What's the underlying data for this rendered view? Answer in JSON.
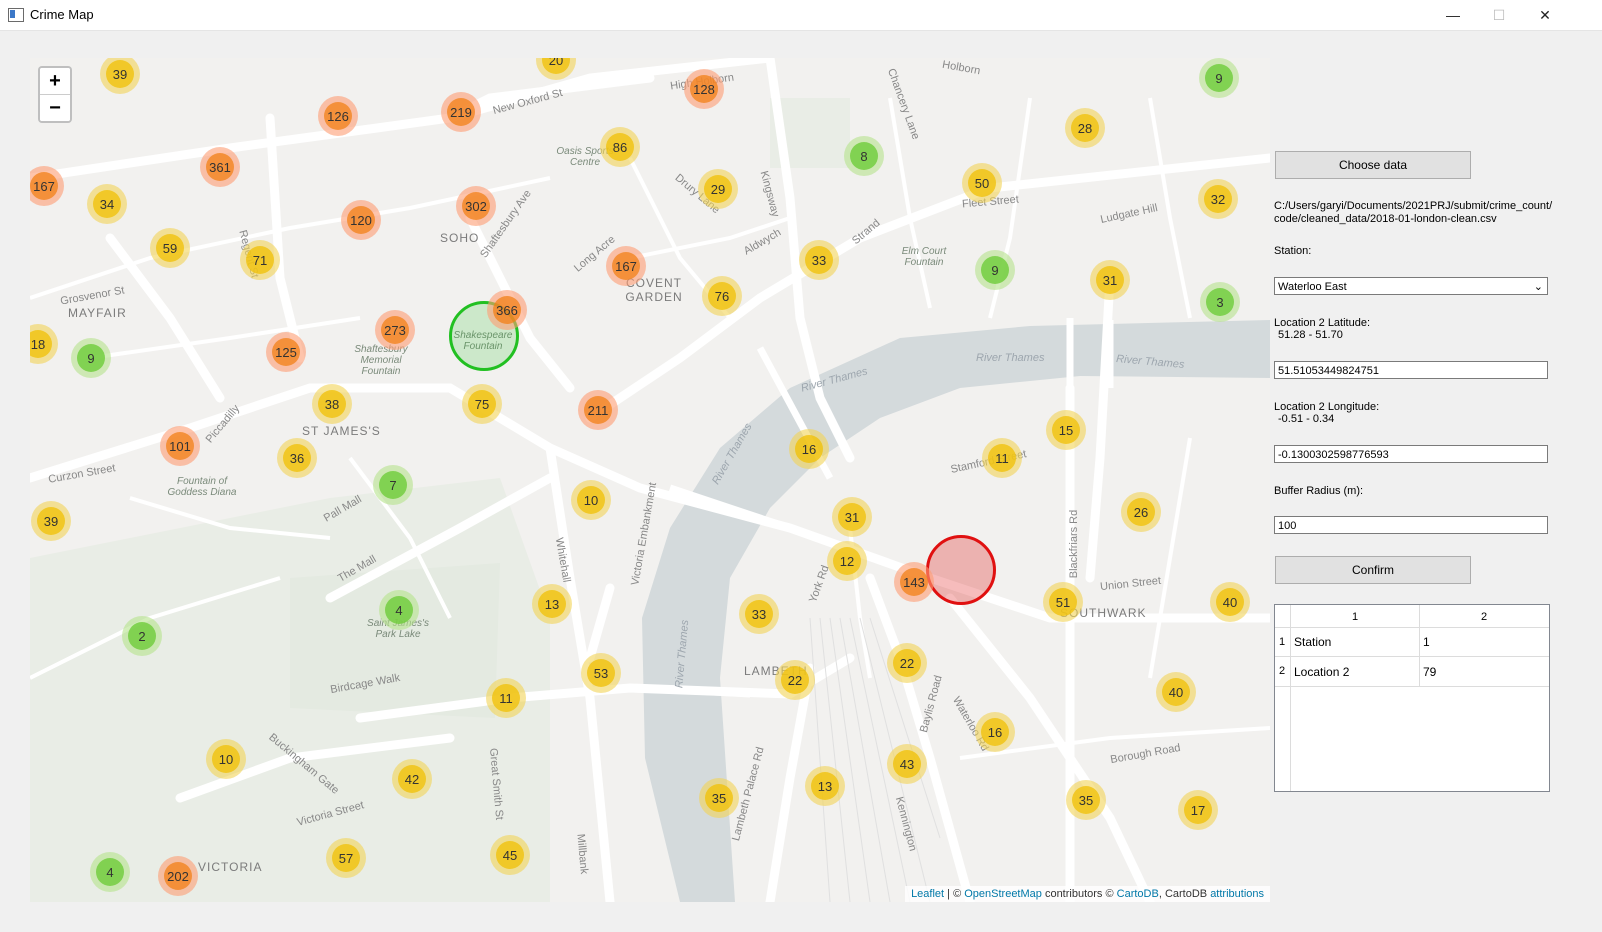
{
  "window": {
    "title": "Crime Map",
    "minimize": "—",
    "maximize": "☐",
    "close": "✕"
  },
  "map": {
    "zoom_in": "+",
    "zoom_out": "−",
    "area_labels": [
      "MAYFAIR",
      "SOHO",
      "COVENT GARDEN",
      "ST JAMES'S",
      "SOUTHWARK",
      "LAMBETH",
      "VICTORIA"
    ],
    "street_labels": [
      "New Oxford St",
      "High Holborn",
      "Holborn",
      "Shaftesbury Ave",
      "Strand",
      "Long Acre",
      "Piccadilly",
      "Pall Mall",
      "The Mall",
      "Whitehall",
      "Victoria Embankment",
      "Stamford Street",
      "Union Street",
      "Blackfriars Rd",
      "Waterloo Rd",
      "Birdcage Walk",
      "Victoria Street",
      "Regent St",
      "Kingsway",
      "Aldwych",
      "Fleet Street",
      "Chancery Lane",
      "Drury Lane",
      "Curzon Street",
      "Grosvenor St",
      "Ludgate Hill",
      "York Rd",
      "Borough Road",
      "Lambeth Palace Rd",
      "Baylis Road",
      "Buckingham Gate",
      "Great Smith St",
      "Millbank",
      "Kennington"
    ],
    "water_labels": [
      "River Thames",
      "River Thames",
      "River Thames",
      "River Thames",
      "River Thames"
    ],
    "park_labels": [
      "Shakespeare Fountain",
      "Shaftesbury Memorial Fountain",
      "Fountain of Goddess Diana",
      "Saint James's Park Lake",
      "Elm Court Fountain",
      "Oasis Sports Centre"
    ],
    "clusters": [
      {
        "count": 39,
        "level": "yellow"
      },
      {
        "count": 20,
        "level": "yellow"
      },
      {
        "count": 126,
        "level": "orange"
      },
      {
        "count": 219,
        "level": "orange"
      },
      {
        "count": 128,
        "level": "orange"
      },
      {
        "count": 9,
        "level": "green"
      },
      {
        "count": 361,
        "level": "orange"
      },
      {
        "count": 167,
        "level": "orange"
      },
      {
        "count": 34,
        "level": "yellow"
      },
      {
        "count": 86,
        "level": "yellow"
      },
      {
        "count": 8,
        "level": "green"
      },
      {
        "count": 28,
        "level": "yellow"
      },
      {
        "count": 302,
        "level": "orange"
      },
      {
        "count": 120,
        "level": "orange"
      },
      {
        "count": 29,
        "level": "yellow"
      },
      {
        "count": 50,
        "level": "yellow"
      },
      {
        "count": 32,
        "level": "yellow"
      },
      {
        "count": 59,
        "level": "yellow"
      },
      {
        "count": 71,
        "level": "yellow"
      },
      {
        "count": 167,
        "level": "orange"
      },
      {
        "count": 33,
        "level": "yellow"
      },
      {
        "count": 9,
        "level": "green"
      },
      {
        "count": 31,
        "level": "yellow"
      },
      {
        "count": 3,
        "level": "green"
      },
      {
        "count": 366,
        "level": "orange"
      },
      {
        "count": 76,
        "level": "yellow"
      },
      {
        "count": 273,
        "level": "orange"
      },
      {
        "count": 18,
        "level": "yellow"
      },
      {
        "count": 9,
        "level": "green"
      },
      {
        "count": 125,
        "level": "orange"
      },
      {
        "count": 38,
        "level": "yellow"
      },
      {
        "count": 75,
        "level": "yellow"
      },
      {
        "count": 211,
        "level": "orange"
      },
      {
        "count": 101,
        "level": "orange"
      },
      {
        "count": 36,
        "level": "yellow"
      },
      {
        "count": 16,
        "level": "yellow"
      },
      {
        "count": 15,
        "level": "yellow"
      },
      {
        "count": 11,
        "level": "yellow"
      },
      {
        "count": 7,
        "level": "green"
      },
      {
        "count": 10,
        "level": "yellow"
      },
      {
        "count": 39,
        "level": "yellow"
      },
      {
        "count": 31,
        "level": "yellow"
      },
      {
        "count": 26,
        "level": "yellow"
      },
      {
        "count": 12,
        "level": "yellow"
      },
      {
        "count": 143,
        "level": "orange"
      },
      {
        "count": 51,
        "level": "yellow"
      },
      {
        "count": 40,
        "level": "yellow"
      },
      {
        "count": 4,
        "level": "green"
      },
      {
        "count": 13,
        "level": "yellow"
      },
      {
        "count": 33,
        "level": "yellow"
      },
      {
        "count": 2,
        "level": "green"
      },
      {
        "count": 53,
        "level": "yellow"
      },
      {
        "count": 22,
        "level": "yellow"
      },
      {
        "count": 22,
        "level": "yellow"
      },
      {
        "count": 11,
        "level": "yellow"
      },
      {
        "count": 40,
        "level": "yellow"
      },
      {
        "count": 16,
        "level": "yellow"
      },
      {
        "count": 10,
        "level": "yellow"
      },
      {
        "count": 42,
        "level": "yellow"
      },
      {
        "count": 43,
        "level": "yellow"
      },
      {
        "count": 35,
        "level": "yellow"
      },
      {
        "count": 13,
        "level": "yellow"
      },
      {
        "count": 35,
        "level": "yellow"
      },
      {
        "count": 17,
        "level": "yellow"
      },
      {
        "count": 57,
        "level": "yellow"
      },
      {
        "count": 45,
        "level": "yellow"
      },
      {
        "count": 4,
        "level": "green"
      },
      {
        "count": 202,
        "level": "orange"
      }
    ],
    "attribution": {
      "leaflet": "Leaflet",
      "sep1": " | © ",
      "osm": "OpenStreetMap",
      "mid": " contributors © ",
      "carto": "CartoDB",
      "mid2": ", CartoDB ",
      "attr": "attributions"
    },
    "colors": {
      "station_circle": "#22c022",
      "location_circle": "#e01010"
    }
  },
  "panel": {
    "choose_data": "Choose data",
    "file_path_line1": "C:/Users/garyi/Documents/2021PRJ/submit/crime_count/",
    "file_path_line2": "code/cleaned_data/2018-01-london-clean.csv",
    "station_label": "Station:",
    "station_value": "Waterloo East",
    "lat_label": "Location 2 Latitude:",
    "lat_range": "51.28 - 51.70",
    "lat_value": "51.51053449824751",
    "lon_label": "Location 2 Longitude:",
    "lon_range": "-0.51 - 0.34",
    "lon_value": "-0.1300302598776593",
    "radius_label": "Buffer Radius (m):",
    "radius_value": "100",
    "confirm": "Confirm",
    "table": {
      "headers": [
        "1",
        "2"
      ],
      "row_headers": [
        "1",
        "2"
      ],
      "rows": [
        [
          "Station",
          "1"
        ],
        [
          "Location 2",
          "79"
        ]
      ]
    }
  }
}
